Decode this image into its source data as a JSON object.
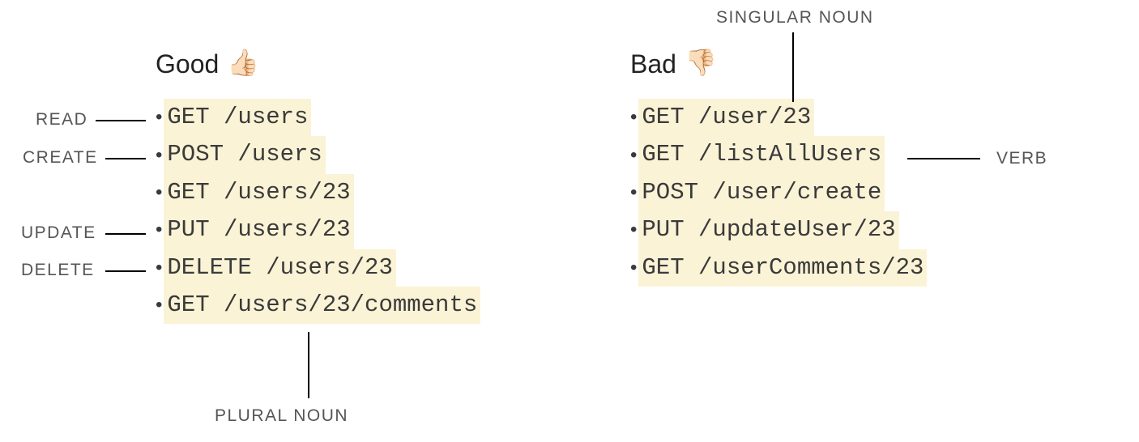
{
  "good": {
    "title": "Good",
    "emoji": "👍🏻",
    "items": [
      "GET /users",
      "POST /users",
      "GET /users/23",
      "PUT /users/23",
      "DELETE /users/23",
      "GET /users/23/comments"
    ],
    "side_annotations": [
      "READ",
      "CREATE",
      "UPDATE",
      "DELETE"
    ],
    "bottom_annotation": "PLURAL NOUN"
  },
  "bad": {
    "title": "Bad",
    "emoji": "👎🏻",
    "items": [
      "GET /user/23",
      "GET /listAllUsers",
      "POST /user/create",
      "PUT /updateUser/23",
      "GET /userComments/23"
    ],
    "top_annotation": "SINGULAR NOUN",
    "right_annotation": "VERB"
  }
}
